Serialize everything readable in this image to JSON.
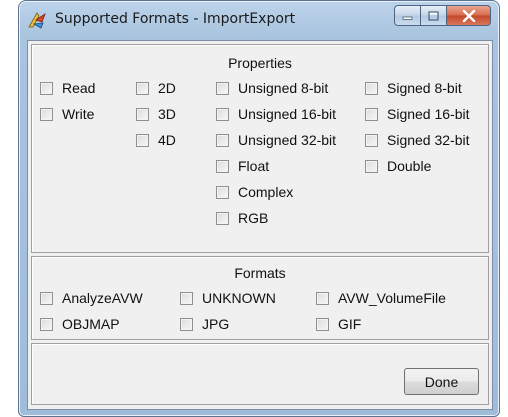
{
  "window": {
    "title": "Supported Formats - ImportExport",
    "app_icon": "app-icon",
    "controls": {
      "minimize": "minimize-icon",
      "maximize": "maximize-icon",
      "close": "close-icon"
    }
  },
  "properties": {
    "title": "Properties",
    "col1": [
      "Read",
      "Write"
    ],
    "col2": [
      "2D",
      "3D",
      "4D"
    ],
    "col3": [
      "Unsigned 8-bit",
      "Unsigned 16-bit",
      "Unsigned 32-bit",
      "Float",
      "Complex",
      "RGB"
    ],
    "col4": [
      "Signed 8-bit",
      "Signed 16-bit",
      "Signed 32-bit",
      "Double"
    ]
  },
  "formats": {
    "title": "Formats",
    "items": [
      "AnalyzeAVW",
      "UNKNOWN",
      "AVW_VolumeFile",
      "OBJMAP",
      "JPG",
      "GIF"
    ]
  },
  "footer": {
    "done_label": "Done"
  },
  "colors": {
    "titlebar": "#a9c4df",
    "client_bg": "#f0f0f0",
    "close_button": "#c4472a"
  }
}
